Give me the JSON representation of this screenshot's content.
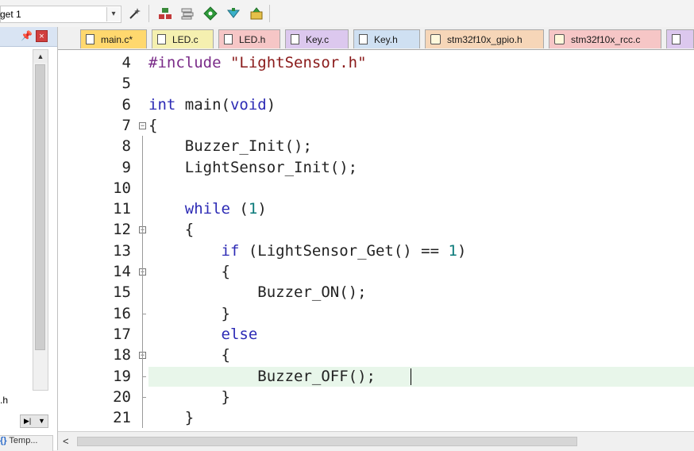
{
  "toolbar": {
    "target": "get 1",
    "icons": [
      "dropdown-icon",
      "options-wand-icon",
      "manage-components-icon",
      "stack-icon",
      "green-diamond-icon",
      "download-icon",
      "pack-installer-icon"
    ]
  },
  "project_panel": {
    "file_label": ".h",
    "bottom_tab": "Temp..."
  },
  "tabs": [
    {
      "label": "main.c*",
      "active": true,
      "color": "#ffd86e",
      "icon": "document-icon"
    },
    {
      "label": "LED.c",
      "active": false,
      "color": "#f5f0b0",
      "icon": "document-icon"
    },
    {
      "label": "LED.h",
      "active": false,
      "color": "#f6c6c6",
      "icon": "document-icon"
    },
    {
      "label": "Key.c",
      "active": false,
      "color": "#dcc8ee",
      "icon": "document-icon"
    },
    {
      "label": "Key.h",
      "active": false,
      "color": "#cfe0f2",
      "icon": "document-icon"
    },
    {
      "label": "stm32f10x_gpio.h",
      "active": false,
      "color": "#f6d6b8",
      "icon": "config-file-icon"
    },
    {
      "label": "stm32f10x_rcc.c",
      "active": false,
      "color": "#f6c6c6",
      "icon": "config-file-icon"
    },
    {
      "label": "",
      "active": false,
      "color": "#dcc8ee",
      "icon": "document-icon"
    }
  ],
  "editor": {
    "lines": [
      {
        "n": "4",
        "tokens": [
          {
            "t": "#include ",
            "c": "pp"
          },
          {
            "t": "\"LightSensor.h\"",
            "c": "str"
          }
        ]
      },
      {
        "n": "5",
        "tokens": []
      },
      {
        "n": "6",
        "tokens": [
          {
            "t": "int",
            "c": "kw"
          },
          {
            "t": " main(",
            "c": ""
          },
          {
            "t": "void",
            "c": "kw"
          },
          {
            "t": ")",
            "c": ""
          }
        ]
      },
      {
        "n": "7",
        "tokens": [
          {
            "t": "{",
            "c": ""
          }
        ]
      },
      {
        "n": "8",
        "tokens": [
          {
            "t": "    Buzzer_Init();",
            "c": ""
          }
        ]
      },
      {
        "n": "9",
        "tokens": [
          {
            "t": "    LightSensor_Init();",
            "c": ""
          }
        ]
      },
      {
        "n": "10",
        "tokens": []
      },
      {
        "n": "11",
        "tokens": [
          {
            "t": "    ",
            "c": ""
          },
          {
            "t": "while",
            "c": "kw"
          },
          {
            "t": " (",
            "c": ""
          },
          {
            "t": "1",
            "c": "num"
          },
          {
            "t": ")",
            "c": ""
          }
        ]
      },
      {
        "n": "12",
        "tokens": [
          {
            "t": "    {",
            "c": ""
          }
        ]
      },
      {
        "n": "13",
        "tokens": [
          {
            "t": "        ",
            "c": ""
          },
          {
            "t": "if",
            "c": "kw"
          },
          {
            "t": " (LightSensor_Get() == ",
            "c": ""
          },
          {
            "t": "1",
            "c": "num"
          },
          {
            "t": ")",
            "c": ""
          }
        ]
      },
      {
        "n": "14",
        "tokens": [
          {
            "t": "        {",
            "c": ""
          }
        ]
      },
      {
        "n": "15",
        "tokens": [
          {
            "t": "            Buzzer_ON();",
            "c": ""
          }
        ]
      },
      {
        "n": "16",
        "tokens": [
          {
            "t": "        }",
            "c": ""
          }
        ]
      },
      {
        "n": "17",
        "tokens": [
          {
            "t": "        ",
            "c": ""
          },
          {
            "t": "else",
            "c": "kw"
          }
        ]
      },
      {
        "n": "18",
        "tokens": [
          {
            "t": "        {",
            "c": ""
          }
        ]
      },
      {
        "n": "19",
        "tokens": [
          {
            "t": "            Buzzer_OFF();",
            "c": ""
          }
        ]
      },
      {
        "n": "20",
        "tokens": [
          {
            "t": "        }",
            "c": ""
          }
        ]
      },
      {
        "n": "21",
        "tokens": [
          {
            "t": "    }",
            "c": ""
          }
        ]
      }
    ]
  },
  "colors": {
    "keyword": "#2d2bb5",
    "string": "#8a1a1a",
    "preprocessor": "#7a2b88",
    "number": "#0a7a7a",
    "current_line": "#e8f6ea"
  }
}
